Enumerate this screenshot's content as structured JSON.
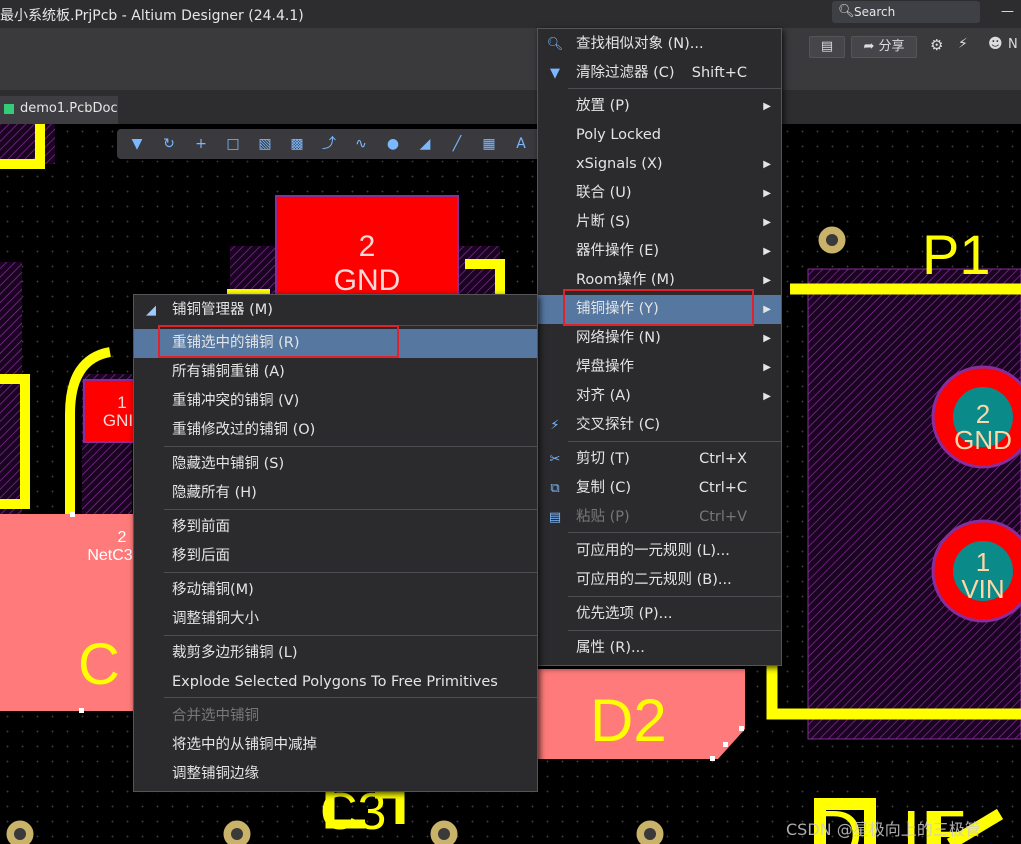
{
  "window": {
    "title": "最小系统板.PrjPcb - Altium Designer (24.4.1)",
    "search_label": "Search",
    "share_label": "分享",
    "user_initial": "N"
  },
  "tabs": {
    "doc": "demo1.PcbDoc"
  },
  "pcb": {
    "pad1_num": "2",
    "pad1_net": "GND",
    "pad2_num": "1",
    "pad2_net": "GNI",
    "pad3_num": "2",
    "pad3_net": "NetC3",
    "label_c": "C",
    "label_d2": "D2",
    "label_c3": "C3",
    "label_p1": "P1",
    "label_bottom": "DLIE",
    "p1pad1_num": "2",
    "p1pad1_net": "GND",
    "p1pad2_num": "1",
    "p1pad2_net": "VIN"
  },
  "main_menu": {
    "items": [
      {
        "label": "查找相似对象 (N)...",
        "shortcut": "",
        "submenu": false,
        "icon": "search-icon"
      },
      {
        "label": "清除过滤器 (C)",
        "shortcut": "Shift+C",
        "submenu": false,
        "icon": "clear-filter-icon"
      },
      {
        "label": "放置 (P)",
        "shortcut": "",
        "submenu": true,
        "icon": ""
      },
      {
        "label": "Poly Locked",
        "shortcut": "",
        "submenu": false,
        "icon": ""
      },
      {
        "label": "xSignals (X)",
        "shortcut": "",
        "submenu": true,
        "icon": ""
      },
      {
        "label": "联合 (U)",
        "shortcut": "",
        "submenu": true,
        "icon": ""
      },
      {
        "label": "片断 (S)",
        "shortcut": "",
        "submenu": true,
        "icon": ""
      },
      {
        "label": "器件操作 (E)",
        "shortcut": "",
        "submenu": true,
        "icon": ""
      },
      {
        "label": "Room操作 (M)",
        "shortcut": "",
        "submenu": true,
        "icon": ""
      },
      {
        "label": "铺铜操作 (Y)",
        "shortcut": "",
        "submenu": true,
        "icon": ""
      },
      {
        "label": "网络操作 (N)",
        "shortcut": "",
        "submenu": true,
        "icon": ""
      },
      {
        "label": "焊盘操作",
        "shortcut": "",
        "submenu": true,
        "icon": ""
      },
      {
        "label": "对齐 (A)",
        "shortcut": "",
        "submenu": true,
        "icon": ""
      },
      {
        "label": "交叉探针 (C)",
        "shortcut": "",
        "submenu": false,
        "icon": "cross-probe-icon"
      },
      {
        "label": "剪切 (T)",
        "shortcut": "Ctrl+X",
        "submenu": false,
        "icon": "cut-icon"
      },
      {
        "label": "复制 (C)",
        "shortcut": "Ctrl+C",
        "submenu": false,
        "icon": "copy-icon"
      },
      {
        "label": "粘贴 (P)",
        "shortcut": "Ctrl+V",
        "submenu": false,
        "icon": "paste-icon"
      },
      {
        "label": "可应用的一元规则 (L)...",
        "shortcut": "",
        "submenu": false,
        "icon": ""
      },
      {
        "label": "可应用的二元规则 (B)...",
        "shortcut": "",
        "submenu": false,
        "icon": ""
      },
      {
        "label": "优先选项 (P)...",
        "shortcut": "",
        "submenu": false,
        "icon": ""
      },
      {
        "label": "属性 (R)...",
        "shortcut": "",
        "submenu": false,
        "icon": ""
      }
    ]
  },
  "sub_menu": {
    "items": [
      {
        "label": "铺铜管理器 (M)"
      },
      {
        "label": "重铺选中的铺铜 (R)"
      },
      {
        "label": "所有铺铜重铺 (A)"
      },
      {
        "label": "重铺冲突的铺铜 (V)"
      },
      {
        "label": "重铺修改过的铺铜 (O)"
      },
      {
        "label": "隐藏选中铺铜 (S)"
      },
      {
        "label": "隐藏所有 (H)"
      },
      {
        "label": "移到前面"
      },
      {
        "label": "移到后面"
      },
      {
        "label": "移动铺铜(M)"
      },
      {
        "label": "调整铺铜大小"
      },
      {
        "label": "裁剪多边形铺铜 (L)"
      },
      {
        "label": "Explode Selected Polygons To Free Primitives"
      },
      {
        "label": "合并选中铺铜"
      },
      {
        "label": "将选中的从铺铜中减掉"
      },
      {
        "label": "调整铺铜边缘"
      }
    ]
  },
  "watermark": "CSDN @星极向上的三极管",
  "colors": {
    "highlight": "#5677a0",
    "annotation_red": "#e0212e",
    "pad_red": "#ff0000",
    "silk_yellow": "#ffff00",
    "pad_teal": "#0b8a8a"
  }
}
